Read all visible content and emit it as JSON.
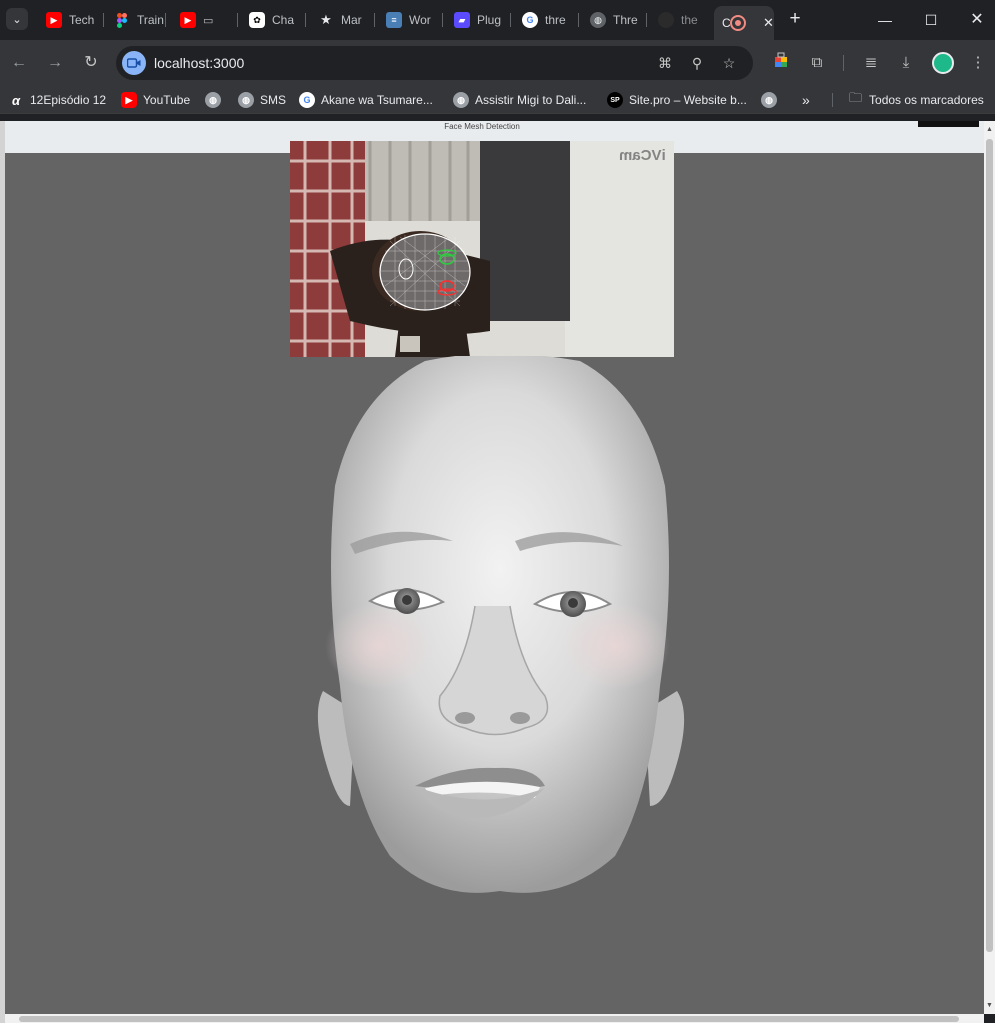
{
  "browser": {
    "tabs": [
      {
        "label": "Tech",
        "icon": "youtube-icon",
        "color": "#ff0000"
      },
      {
        "label": "Train",
        "icon": "figma-icon",
        "color": "#f24e1e"
      },
      {
        "label": "",
        "icon": "youtube-icon",
        "color": "#ff0000"
      },
      {
        "label": "Cha",
        "icon": "chatgpt-icon",
        "color": "#ffffff"
      },
      {
        "label": "Mar",
        "icon": "star-icon",
        "color": "#e8eaed"
      },
      {
        "label": "Wor",
        "icon": "doc-icon",
        "color": "#4a90d9"
      },
      {
        "label": "Plug",
        "icon": "plugin-icon",
        "color": "#5b4bff"
      },
      {
        "label": "thre",
        "icon": "google-icon",
        "color": "#4285f4"
      },
      {
        "label": "Thre",
        "icon": "globe-icon",
        "color": "#9aa0a6"
      },
      {
        "label": "the",
        "icon": "github-icon",
        "color": "#3c3c3c"
      },
      {
        "label": "C",
        "icon": "record-icon",
        "color": "#e8eaed",
        "active": true
      }
    ],
    "address": {
      "url": "localhost:3000"
    },
    "bookmarks": [
      {
        "label": "12Episódio 12",
        "icon": "anime-icon"
      },
      {
        "label": "YouTube",
        "icon": "youtube-icon"
      },
      {
        "label": "",
        "icon": "globe-icon"
      },
      {
        "label": "SMS",
        "icon": "globe-icon"
      },
      {
        "label": "Akane wa Tsumare...",
        "icon": "google-icon"
      },
      {
        "label": "Assistir Migi to Dali...",
        "icon": "globe-icon"
      },
      {
        "label": "Site.pro – Website b...",
        "icon": "sitepro-icon"
      },
      {
        "label": "",
        "icon": "globe-icon"
      }
    ],
    "overflow_label": "»",
    "all_bookmarks_label": "Todos os marcadores"
  },
  "page": {
    "title": "Face Mesh Detection",
    "webcam_brand": "iVCam"
  }
}
